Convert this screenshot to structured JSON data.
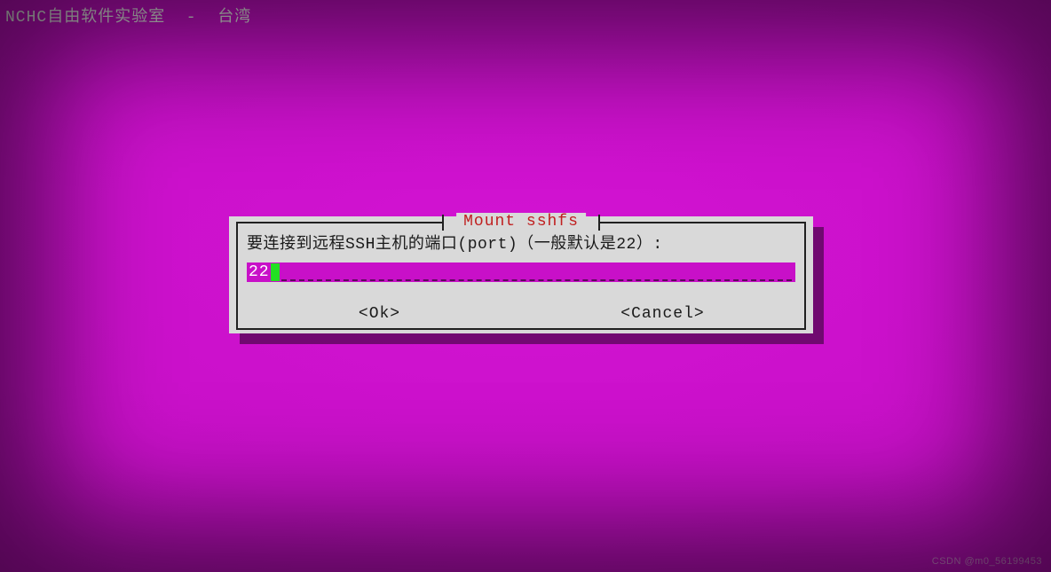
{
  "header": {
    "title": "NCHC自由软件实验室  -  台湾"
  },
  "dialog": {
    "title": "Mount sshfs",
    "prompt": "要连接到远程SSH主机的端口(port)（一般默认是22）:",
    "input_value": "22",
    "ok_label": "<Ok>",
    "cancel_label": "<Cancel>"
  },
  "watermark": "CSDN @m0_56199453",
  "colors": {
    "background_magenta": "#c810c8",
    "dialog_grey": "#d9d9d9",
    "title_red": "#c02020",
    "cursor_green": "#22e022"
  }
}
